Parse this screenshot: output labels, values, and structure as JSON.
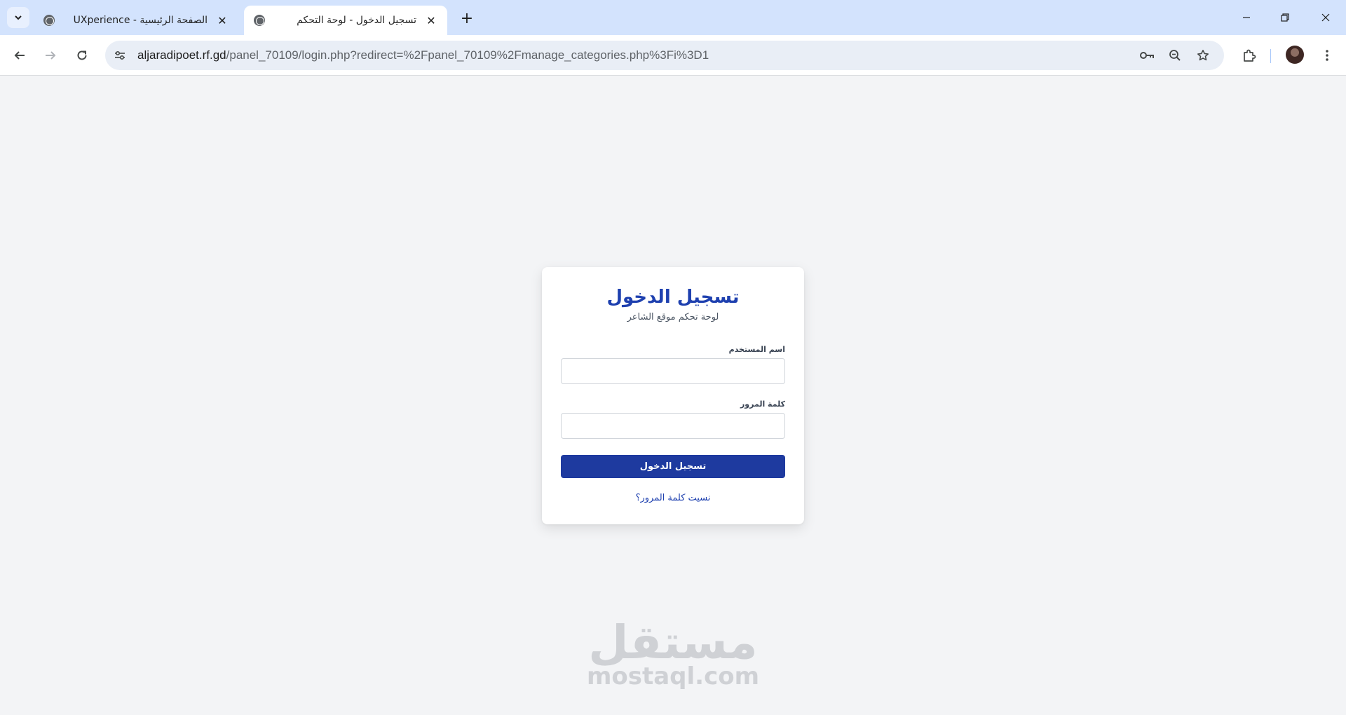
{
  "browser": {
    "tabs": [
      {
        "title": "الصفحة الرئيسية - UXperience",
        "active": false
      },
      {
        "title": "تسجيل الدخول - لوحة التحكم",
        "active": true
      }
    ],
    "url_host": "aljaradipoet.rf.gd",
    "url_path": "/panel_70109/login.php?redirect=%2Fpanel_70109%2Fmanage_categories.php%3Fi%3D1",
    "icons": {
      "tab_search": "chevron-down-icon",
      "favicon": "globe-icon",
      "new_tab": "plus-icon",
      "back": "arrow-left-icon",
      "forward": "arrow-right-icon",
      "reload": "reload-icon",
      "site_info": "tune-icon",
      "password": "key-icon",
      "zoom": "zoom-out-icon",
      "bookmark": "star-icon",
      "extensions": "puzzle-icon",
      "menu": "kebab-icon"
    }
  },
  "login": {
    "title": "تسجيل الدخول",
    "subtitle": "لوحة تحكم موقع الشاعر",
    "username_label": "اسم المستخدم",
    "username_value": "",
    "password_label": "كلمة المرور",
    "password_value": "",
    "submit_label": "تسجيل الدخول",
    "forgot_label": "نسيت كلمة المرور؟"
  },
  "watermark": {
    "arabic": "مستقل",
    "latin": "mostaql.com"
  },
  "colors": {
    "primary": "#1e3a9f",
    "heading": "#1e40af",
    "page_bg": "#f3f4f6",
    "tabstrip_bg": "#d3e3fd"
  }
}
